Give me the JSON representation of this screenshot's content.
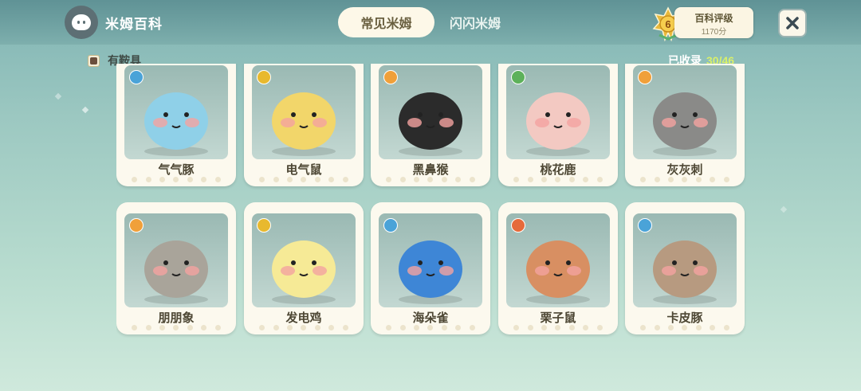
{
  "header": {
    "app_title": "米姆百科",
    "tabs": [
      {
        "label": "常见米姆",
        "active": true
      },
      {
        "label": "闪闪米姆",
        "active": false
      }
    ],
    "rating": {
      "level": "6",
      "title": "百科评级",
      "score": "1170分"
    }
  },
  "filter": {
    "label": "有鞍具",
    "checked": true
  },
  "collection": {
    "label": "已收录",
    "count": "30/46"
  },
  "creatures": [
    {
      "name": "气气豚",
      "element": "water",
      "color": "#8fd0e8"
    },
    {
      "name": "电气鼠",
      "element": "electric",
      "color": "#f2d66a"
    },
    {
      "name": "黑鼻猴",
      "element": "fire",
      "color": "#2b2b2b"
    },
    {
      "name": "桃花鹿",
      "element": "grass",
      "color": "#f3c9c2"
    },
    {
      "name": "灰灰刺",
      "element": "fire",
      "color": "#8a8a88"
    },
    {
      "name": "朋朋象",
      "element": "fire",
      "color": "#a9a49a"
    },
    {
      "name": "发电鸡",
      "element": "electric",
      "color": "#f6ea96"
    },
    {
      "name": "海朵雀",
      "element": "water",
      "color": "#3e86d6"
    },
    {
      "name": "栗子鼠",
      "element": "burn",
      "color": "#d88f62"
    },
    {
      "name": "卡皮豚",
      "element": "water",
      "color": "#b79a80"
    }
  ],
  "colors": {
    "accent": "#d9f06a",
    "card": "#fcf9ee",
    "active_tab": "#fdf8e8"
  }
}
